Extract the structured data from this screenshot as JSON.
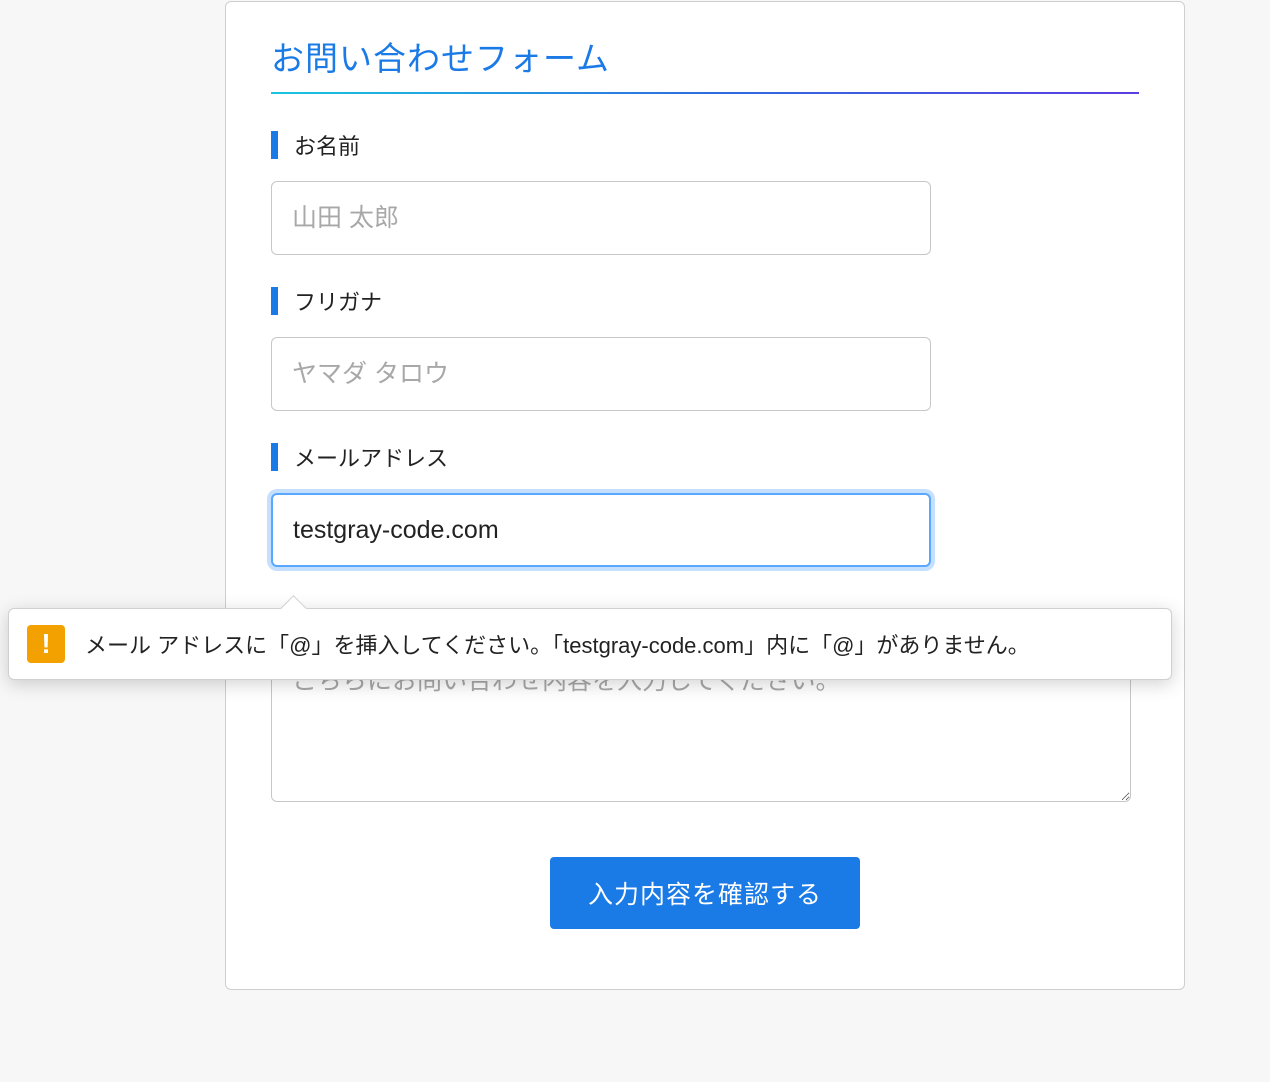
{
  "form": {
    "title": "お問い合わせフォーム",
    "fields": {
      "name": {
        "label": "お名前",
        "placeholder": "山田 太郎",
        "value": ""
      },
      "furigana": {
        "label": "フリガナ",
        "placeholder": "ヤマダ タロウ",
        "value": ""
      },
      "email": {
        "label": "メールアドレス",
        "placeholder": "",
        "value": "testgray-code.com"
      },
      "content": {
        "placeholder": "こちらにお問い合わせ内容を入力してください。",
        "value": ""
      }
    },
    "submit_label": "入力内容を確認する"
  },
  "validation_tooltip": {
    "icon": "!",
    "message": "メール アドレスに「@」を挿入してください。「testgray-code.com」内に「@」がありません。"
  }
}
